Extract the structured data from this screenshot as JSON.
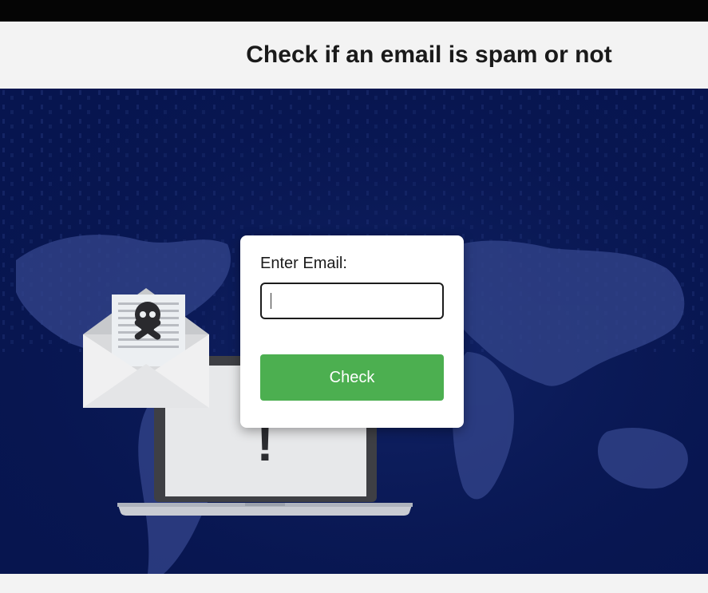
{
  "header": {
    "title": "Check if an email is spam or not"
  },
  "form": {
    "email_label": "Enter Email:",
    "email_value": "",
    "check_label": "Check"
  },
  "colors": {
    "hero_background": "#07154f",
    "button": "#4caf50",
    "top_bar": "#050505",
    "header_background": "#f3f3f3"
  },
  "illustration": {
    "icons": [
      "world-map-icon",
      "spam-envelope-icon",
      "skull-crossbones-icon",
      "laptop-warning-icon"
    ],
    "laptop_mark": "!"
  }
}
